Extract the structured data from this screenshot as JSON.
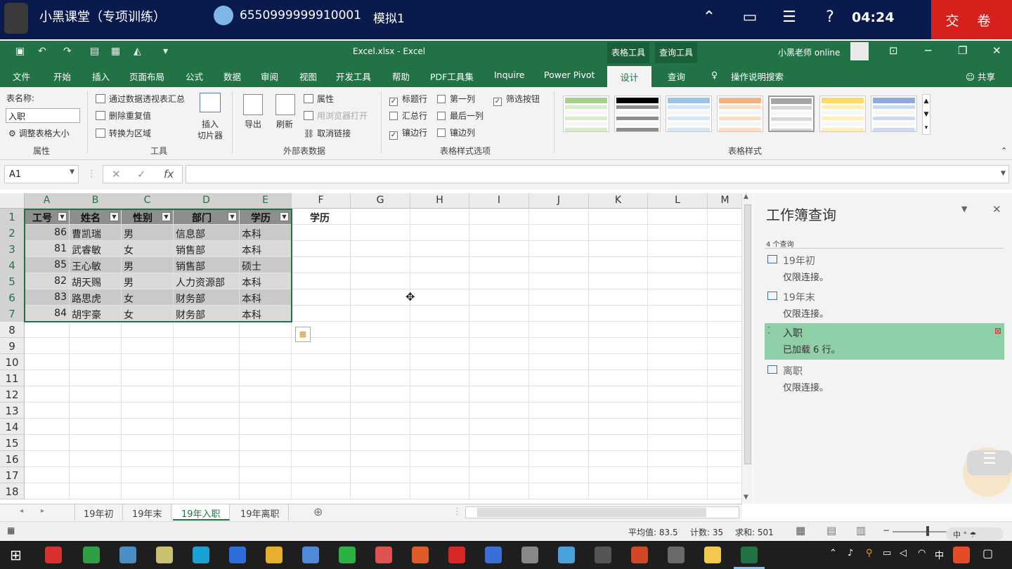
{
  "exam": {
    "title": "小黑课堂（专项训练）",
    "user_id": "6550999999910001",
    "mode": "模拟1",
    "timer": "04:24",
    "submit": "交 卷",
    "help_icon": "?"
  },
  "excel": {
    "file_title": "Excel.xlsx  -  Excel",
    "context_tabs": [
      "表格工具",
      "查询工具"
    ],
    "user": "小黑老师 online",
    "tabs": [
      "文件",
      "开始",
      "插入",
      "页面布局",
      "公式",
      "数据",
      "审阅",
      "视图",
      "开发工具",
      "帮助",
      "PDF工具集",
      "Inquire",
      "Power Pivot",
      "设计",
      "查询"
    ],
    "tell_me": "操作说明搜索",
    "share": "共享"
  },
  "ribbon": {
    "props": {
      "label": "表名称:",
      "value": "入职",
      "resize": "调整表格大小",
      "group": "属性"
    },
    "tools": {
      "pivot": "通过数据透视表汇总",
      "dedupe": "删除重复值",
      "convert": "转换为区域",
      "slicer1": "插入",
      "slicer2": "切片器",
      "group": "工具"
    },
    "external": {
      "export": "导出",
      "refresh": "刷新",
      "props": "属性",
      "open_browser": "用浏览器打开",
      "unlink": "取消链接",
      "group": "外部表数据"
    },
    "options": {
      "header_row": "标题行",
      "first_col": "第一列",
      "filter_btn": "筛选按钮",
      "total_row": "汇总行",
      "last_col": "最后一列",
      "banded_rows": "镶边行",
      "banded_cols": "镶边列",
      "group": "表格样式选项"
    },
    "styles_group": "表格样式",
    "style_colors": [
      "#a8d08d",
      "#000000",
      "#9dc3e6",
      "#f4b183",
      "#a5a5a5",
      "#ffd966",
      "#8faadc"
    ]
  },
  "formula": {
    "namebox": "A1",
    "cancel": "✕",
    "enter": "✓",
    "fx": "fx",
    "content": ""
  },
  "grid": {
    "columns": [
      "A",
      "B",
      "C",
      "D",
      "E",
      "F",
      "G",
      "H",
      "I",
      "J",
      "K",
      "L",
      "M"
    ],
    "rows": [
      "1",
      "2",
      "3",
      "4",
      "5",
      "6",
      "7",
      "8",
      "9",
      "10",
      "11",
      "12",
      "13",
      "14",
      "15",
      "16",
      "17",
      "18"
    ],
    "headers": [
      "工号",
      "姓名",
      "性别",
      "部门",
      "学历"
    ],
    "f1": "学历",
    "data": [
      [
        "86",
        "曹凯瑞",
        "男",
        "信息部",
        "本科"
      ],
      [
        "81",
        "武睿敏",
        "女",
        "销售部",
        "本科"
      ],
      [
        "85",
        "王心敏",
        "男",
        "销售部",
        "硕士"
      ],
      [
        "82",
        "胡天赐",
        "男",
        "人力资源部",
        "本科"
      ],
      [
        "83",
        "路思虎",
        "女",
        "财务部",
        "本科"
      ],
      [
        "84",
        "胡宇豪",
        "女",
        "财务部",
        "本科"
      ]
    ]
  },
  "pane": {
    "title": "工作簿查询",
    "count": "4 个查询",
    "queries": [
      {
        "name": "19年初",
        "status": "仅限连接。"
      },
      {
        "name": "19年末",
        "status": "仅限连接。"
      },
      {
        "name": "入职",
        "status": "已加载 6 行。"
      },
      {
        "name": "离职",
        "status": "仅限连接。"
      }
    ]
  },
  "sheets": [
    "19年初",
    "19年末",
    "19年入职",
    "19年离职"
  ],
  "status": {
    "avg": "平均值: 83.5",
    "count": "计数: 35",
    "sum": "求和: 501"
  }
}
